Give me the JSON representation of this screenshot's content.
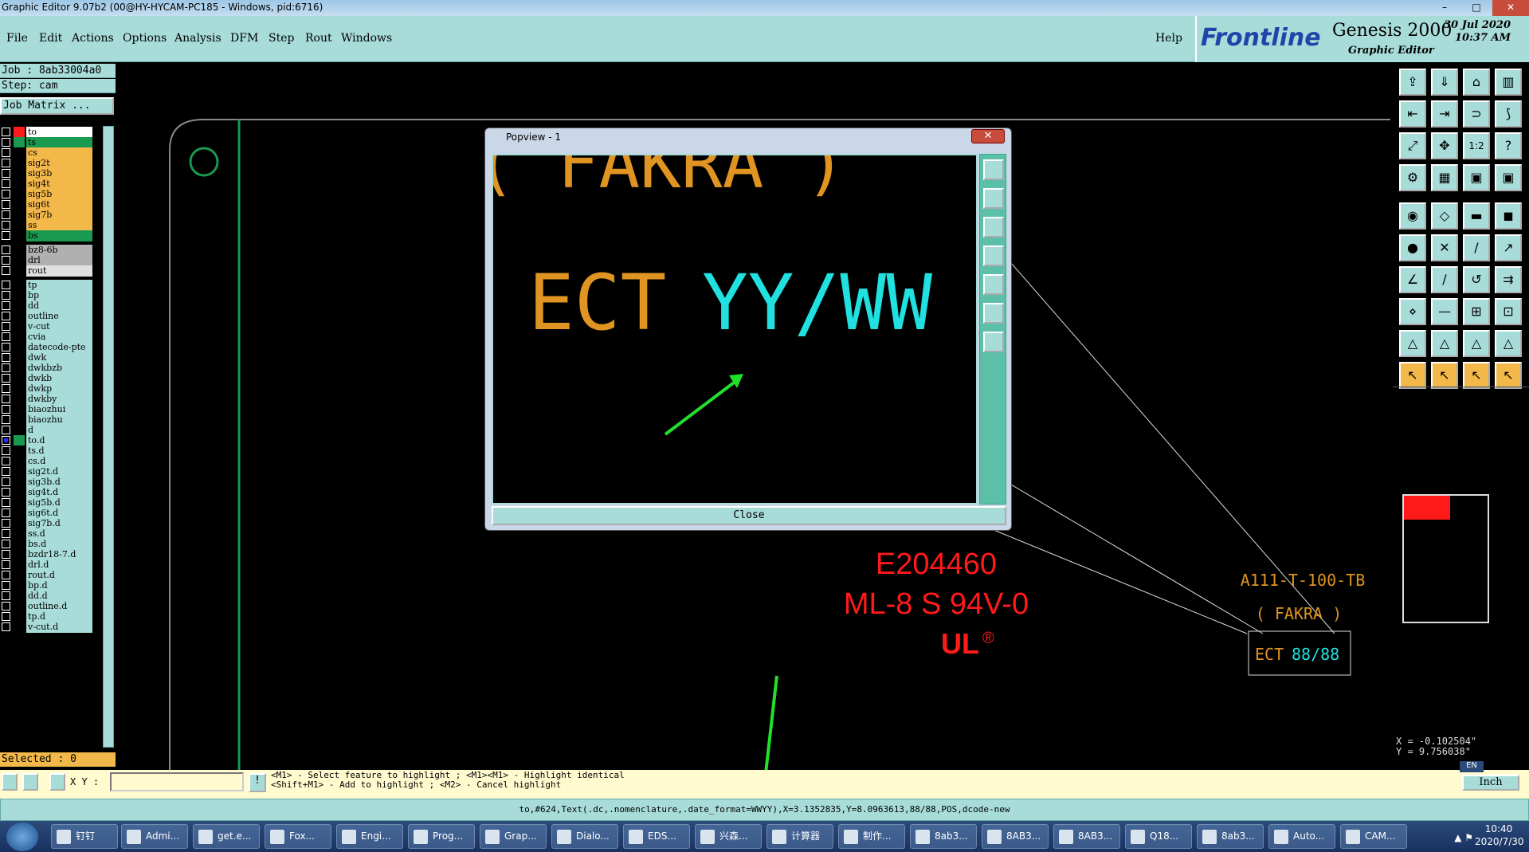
{
  "window": {
    "title": "Graphic Editor 9.07b2 (00@HY-HYCAM-PC185 - Windows, pid:6716)",
    "min": "–",
    "max": "□",
    "close": "✕"
  },
  "menu": {
    "file": "File",
    "edit": "Edit",
    "actions": "Actions",
    "options": "Options",
    "analysis": "Analysis",
    "dfm": "DFM",
    "step": "Step",
    "rout": "Rout",
    "windows": "Windows",
    "help": "Help"
  },
  "brand": {
    "logo": "Frontline",
    "product": "Genesis 2000",
    "sub": "Graphic Editor",
    "date": "30 Jul 2020",
    "time": "10:37 AM"
  },
  "job": {
    "job": "Job : 8ab33004a0",
    "step": "Step: cam",
    "matrix": "Job Matrix ..."
  },
  "layers": [
    "to",
    "ts",
    "cs",
    "sig2t",
    "sig3b",
    "sig4t",
    "sig5b",
    "sig6t",
    "sig7b",
    "ss",
    "bs",
    "bz8-6b",
    "drl",
    "rout",
    "tp",
    "bp",
    "dd",
    "outline",
    "v-cut",
    "cvia",
    "datecode-pte",
    "dwk",
    "dwkbzb",
    "dwkb",
    "dwkp",
    "dwkby",
    "biaozhui",
    "biaozhu",
    "d",
    "to.d",
    "ts.d",
    "cs.d",
    "sig2t.d",
    "sig3b.d",
    "sig4t.d",
    "sig5b.d",
    "sig6t.d",
    "sig7b.d",
    "ss.d",
    "bs.d",
    "bzdr18-7.d",
    "drl.d",
    "rout.d",
    "bp.d",
    "dd.d",
    "outline.d",
    "tp.d",
    "v-cut.d"
  ],
  "selected": "Selected : 0",
  "canvas": {
    "ul": "E204460",
    "rating": "ML-8 S 94V-0",
    "ul_mark": "®",
    "pn": "A111-T-100-TB",
    "fakra": "( FAKRA )",
    "ect": "ECT",
    "code": "88/88"
  },
  "popup": {
    "title": "Popview - 1",
    "close": "Close",
    "fakra": "( FAKRA )",
    "ect": "ECT",
    "code": "YY/WW"
  },
  "status": {
    "xy_label": "X Y :",
    "hint1": "<M1> - Select feature to highlight ; <M1><M1> - Highlight identical",
    "hint2": "<Shift+M1> - Add to highlight ; <M2> - Cancel highlight",
    "coord_x": "X = -0.102504\"",
    "coord_y": "Y = 9.756038\"",
    "unit": "Inch",
    "lang": "EN"
  },
  "info": "to,#624,Text(.dc,.nomenclature,.date_format=WWYY),X=3.1352835,Y=8.0963613,88/88,POS,dcode-new",
  "taskbar": [
    {
      "l": "钉钉"
    },
    {
      "l": "Admi..."
    },
    {
      "l": "get.e..."
    },
    {
      "l": "Fox..."
    },
    {
      "l": "Engi..."
    },
    {
      "l": "Prog..."
    },
    {
      "l": "Grap..."
    },
    {
      "l": "Dialo..."
    },
    {
      "l": "EDS..."
    },
    {
      "l": "兴森..."
    },
    {
      "l": "计算器"
    },
    {
      "l": "制作..."
    },
    {
      "l": "8ab3..."
    },
    {
      "l": "8AB3..."
    },
    {
      "l": "8AB3..."
    },
    {
      "l": "Q18..."
    },
    {
      "l": "8ab3..."
    },
    {
      "l": "Auto..."
    },
    {
      "l": "CAM..."
    }
  ],
  "clock": {
    "time": "10:40",
    "date": "2020/7/30"
  },
  "colors": {
    "panel": "#a8dcd8",
    "orange": "#f2b84a",
    "green": "#1a9a50",
    "red": "#ff1a1a",
    "cyan": "#20e0e0"
  }
}
